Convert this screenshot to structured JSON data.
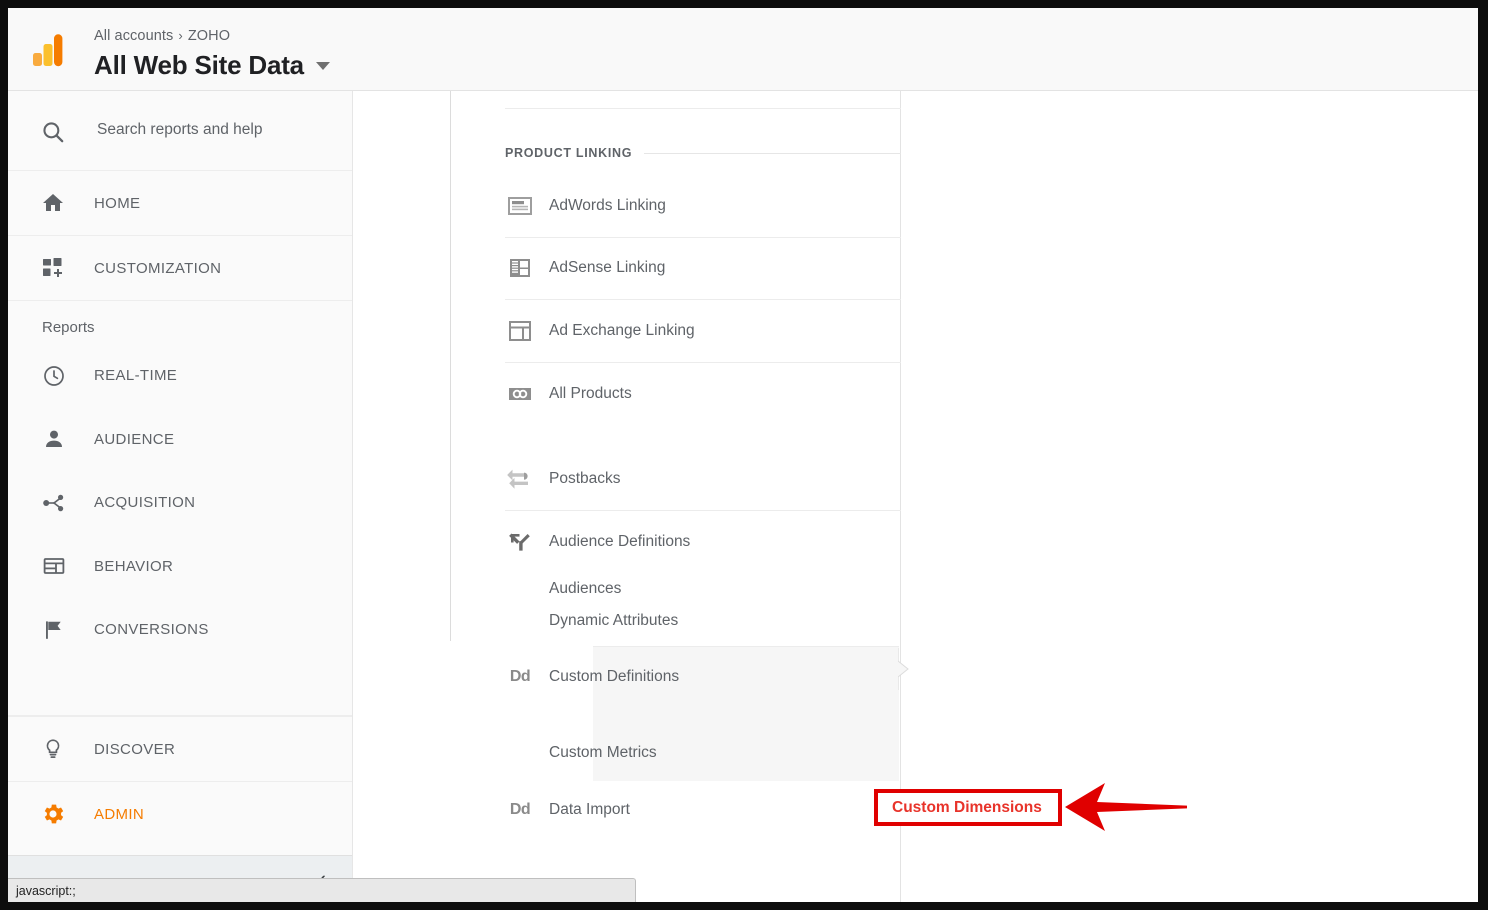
{
  "header": {
    "breadcrumb_root": "All accounts",
    "breadcrumb_sep": "›",
    "breadcrumb_account": "ZOHO",
    "view_title": "All Web Site Data",
    "logo_name": "google-analytics-logo"
  },
  "sidebar": {
    "search_placeholder": "Search reports and help",
    "top_items": [
      {
        "label": "HOME",
        "icon": "home-icon"
      },
      {
        "label": "CUSTOMIZATION",
        "icon": "customization-icon"
      }
    ],
    "reports_label": "Reports",
    "report_items": [
      {
        "label": "REAL-TIME",
        "icon": "clock-icon"
      },
      {
        "label": "AUDIENCE",
        "icon": "person-icon"
      },
      {
        "label": "ACQUISITION",
        "icon": "acquisition-icon"
      },
      {
        "label": "BEHAVIOR",
        "icon": "behavior-icon"
      },
      {
        "label": "CONVERSIONS",
        "icon": "flag-icon"
      }
    ],
    "bottom_items": [
      {
        "label": "DISCOVER",
        "icon": "lightbulb-icon",
        "active": false
      },
      {
        "label": "ADMIN",
        "icon": "gear-icon",
        "active": true
      }
    ],
    "collapse_icon": "chevron-left-icon"
  },
  "admin_panel": {
    "section_title": "PRODUCT LINKING",
    "rows": [
      {
        "label": "AdWords Linking",
        "icon": "adwords-icon"
      },
      {
        "label": "AdSense Linking",
        "icon": "adsense-icon"
      },
      {
        "label": "Ad Exchange Linking",
        "icon": "adexchange-icon"
      },
      {
        "label": "All Products",
        "icon": "all-products-icon"
      },
      {
        "label": "Postbacks",
        "icon": "postbacks-icon"
      },
      {
        "label": "Audience Definitions",
        "icon": "audience-definitions-icon"
      }
    ],
    "audience_subitems": [
      {
        "label": "Audiences"
      },
      {
        "label": "Dynamic Attributes"
      }
    ],
    "custom_definitions": {
      "label": "Custom Definitions",
      "icon": "dd-icon",
      "subitems": [
        {
          "label": "Custom Dimensions",
          "highlighted": true
        },
        {
          "label": "Custom Metrics",
          "highlighted": false
        }
      ]
    },
    "data_import": {
      "label": "Data Import",
      "icon": "dd-icon"
    }
  },
  "annotation": {
    "box_color": "#e00000",
    "text_color": "#e8332a",
    "arrow_color": "#e00000",
    "arrow_name": "red-pointer-arrow",
    "target_label": "Custom Dimensions"
  },
  "status_bar": {
    "text": "javascript:;"
  },
  "colors": {
    "accent_orange": "#f57c00",
    "sidebar_bg": "#fafafa",
    "text_gray": "#5f6368",
    "highlight_bg": "#f6f6f6"
  }
}
